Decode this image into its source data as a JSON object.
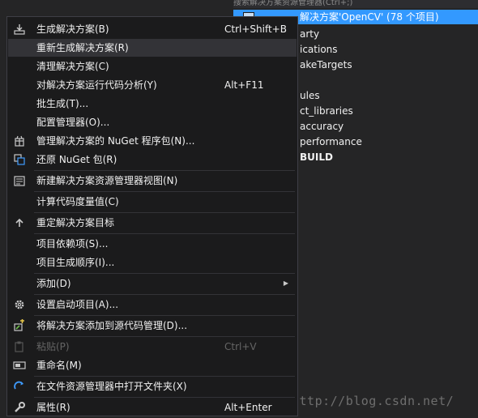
{
  "explorer": {
    "top_text": "搜索解决方案资源管理器(Ctrl+;)",
    "selected_row": "解决方案'OpenCV' (78 个项目)",
    "rows": [
      "arty",
      "ications",
      "akeTargets",
      "",
      "ules",
      "ct_libraries",
      "accuracy",
      "performance",
      "BUILD"
    ]
  },
  "watermark": "http://blog.csdn.net/",
  "menu": {
    "items": [
      {
        "label": "生成解决方案(B)",
        "shortcut": "Ctrl+Shift+B",
        "icon": "build-icon"
      },
      {
        "label": "重新生成解决方案(R)",
        "shortcut": "",
        "icon": ""
      },
      {
        "label": "清理解决方案(C)",
        "shortcut": "",
        "icon": ""
      },
      {
        "label": "对解决方案运行代码分析(Y)",
        "shortcut": "Alt+F11",
        "icon": ""
      },
      {
        "label": "批生成(T)...",
        "shortcut": "",
        "icon": ""
      },
      {
        "label": "配置管理器(O)...",
        "shortcut": "",
        "icon": ""
      },
      {
        "label": "管理解决方案的 NuGet 程序包(N)...",
        "shortcut": "",
        "icon": "nuget-package-icon"
      },
      {
        "label": "还原 NuGet 包(R)",
        "shortcut": "",
        "icon": "restore-icon"
      },
      {
        "label": "新建解决方案资源管理器视图(N)",
        "shortcut": "",
        "icon": "new-view-icon"
      },
      {
        "label": "计算代码度量值(C)",
        "shortcut": "",
        "icon": ""
      },
      {
        "label": "重定解决方案目标",
        "shortcut": "",
        "icon": "retarget-icon"
      },
      {
        "label": "项目依赖项(S)...",
        "shortcut": "",
        "icon": ""
      },
      {
        "label": "项目生成顺序(I)...",
        "shortcut": "",
        "icon": ""
      },
      {
        "label": "添加(D)",
        "shortcut": "",
        "icon": ""
      },
      {
        "label": "设置启动项目(A)...",
        "shortcut": "",
        "icon": "gear-icon"
      },
      {
        "label": "将解决方案添加到源代码管理(D)...",
        "shortcut": "",
        "icon": "source-control-icon"
      },
      {
        "label": "粘贴(P)",
        "shortcut": "Ctrl+V",
        "icon": "paste-icon"
      },
      {
        "label": "重命名(M)",
        "shortcut": "",
        "icon": "rename-icon"
      },
      {
        "label": "在文件资源管理器中打开文件夹(X)",
        "shortcut": "",
        "icon": "refresh-arrow-icon"
      },
      {
        "label": "属性(R)",
        "shortcut": "Alt+Enter",
        "icon": "wrench-icon"
      }
    ]
  }
}
